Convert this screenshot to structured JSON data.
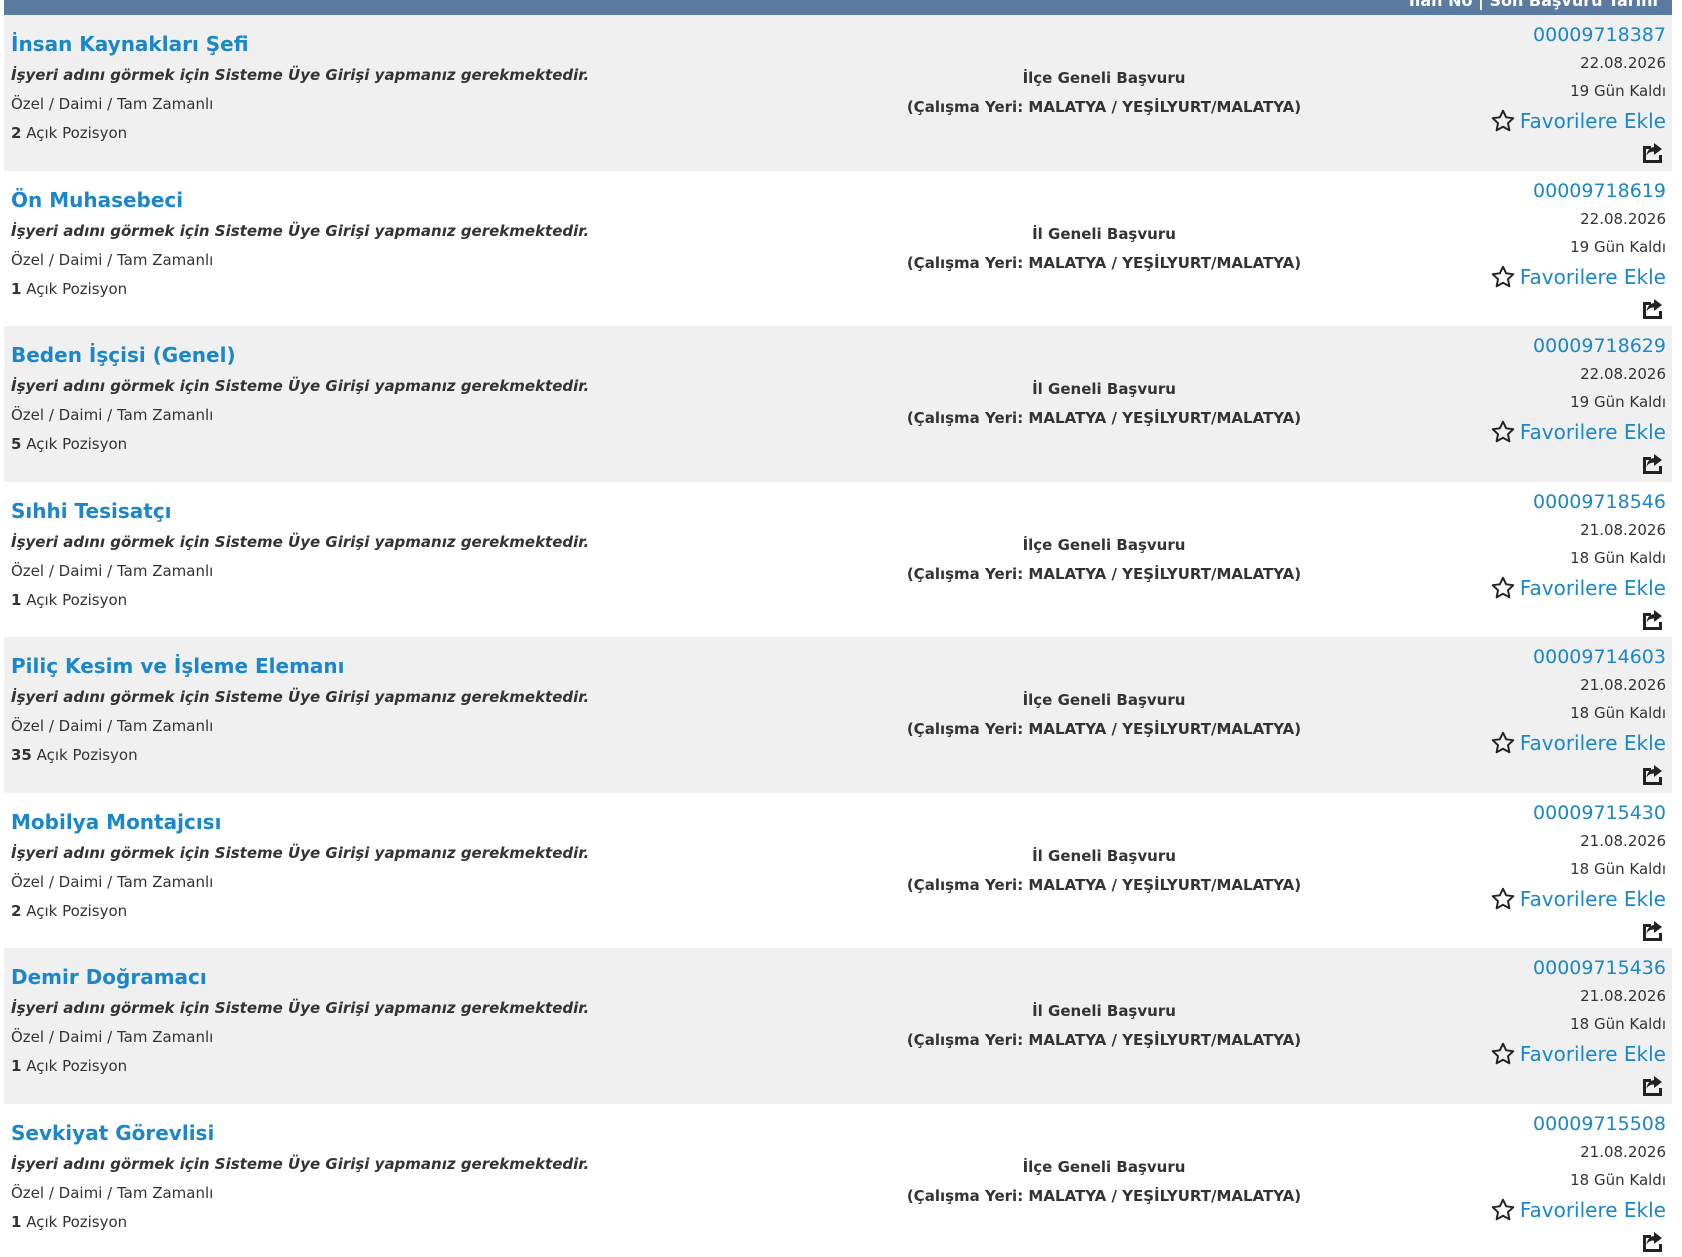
{
  "header": {
    "text": "İlan No | Son Başvuru Tarihi"
  },
  "common": {
    "employer_note": "İşyeri adını görmek için Sisteme Üye Girişi yapmanız gerekmektedir.",
    "job_type": "Özel / Daimi / Tam Zamanlı",
    "positions_suffix": " Açık Pozisyon",
    "location": "(Çalışma Yeri: MALATYA / YEŞİLYURT/MALATYA)",
    "favorite_label": "Favorilere Ekle"
  },
  "colors": {
    "link": "#1b87c9",
    "text": "#333333",
    "row_alt": "#f0f0f1",
    "header_bar": "#5a7aa0"
  },
  "icons": {
    "favorite": "star-outline-icon",
    "share": "share-icon"
  },
  "jobs": [
    {
      "title": "İnsan Kaynakları Şefi",
      "positions": "2",
      "scope": "İlçe Geneli Başvuru",
      "ad_no": "00009718387",
      "date": "22.08.2026",
      "days_left": "19 Gün Kaldı"
    },
    {
      "title": "Ön Muhasebeci",
      "positions": "1",
      "scope": "İl Geneli Başvuru",
      "ad_no": "00009718619",
      "date": "22.08.2026",
      "days_left": "19 Gün Kaldı"
    },
    {
      "title": "Beden İşçisi (Genel)",
      "positions": "5",
      "scope": "İl Geneli Başvuru",
      "ad_no": "00009718629",
      "date": "22.08.2026",
      "days_left": "19 Gün Kaldı"
    },
    {
      "title": "Sıhhi Tesisatçı",
      "positions": "1",
      "scope": "İlçe Geneli Başvuru",
      "ad_no": "00009718546",
      "date": "21.08.2026",
      "days_left": "18 Gün Kaldı"
    },
    {
      "title": "Piliç Kesim ve İşleme Elemanı",
      "positions": "35",
      "scope": "İlçe Geneli Başvuru",
      "ad_no": "00009714603",
      "date": "21.08.2026",
      "days_left": "18 Gün Kaldı"
    },
    {
      "title": "Mobilya Montajcısı",
      "positions": "2",
      "scope": "İl Geneli Başvuru",
      "ad_no": "00009715430",
      "date": "21.08.2026",
      "days_left": "18 Gün Kaldı"
    },
    {
      "title": "Demir Doğramacı",
      "positions": "1",
      "scope": "İl Geneli Başvuru",
      "ad_no": "00009715436",
      "date": "21.08.2026",
      "days_left": "18 Gün Kaldı"
    },
    {
      "title": "Sevkiyat Görevlisi",
      "positions": "1",
      "scope": "İlçe Geneli Başvuru",
      "ad_no": "00009715508",
      "date": "21.08.2026",
      "days_left": "18 Gün Kaldı"
    }
  ]
}
